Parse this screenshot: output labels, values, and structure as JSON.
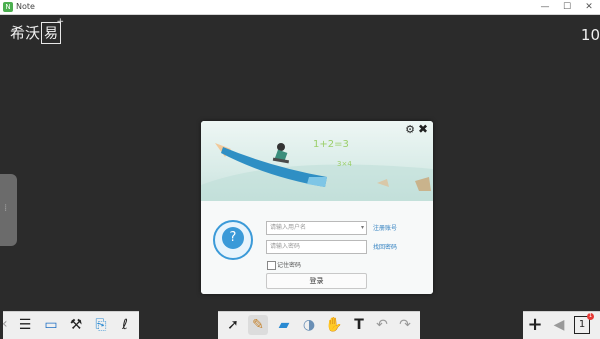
{
  "window": {
    "title": "Note",
    "buttons": [
      "—",
      "☐",
      "✕"
    ]
  },
  "logo": {
    "text": "希沃",
    "boxed": "易",
    "plus": "+"
  },
  "page_indicator": "10",
  "dialog": {
    "username_placeholder": "请输入用户名",
    "password_placeholder": "请输入密码",
    "register_link": "注册账号",
    "forgot_link": "找回密码",
    "remember_label": "记住密码",
    "login_button": "登录",
    "banner_text": "1+2=3"
  },
  "icons": {
    "left_toolbar": [
      "menu-icon",
      "monitor-icon",
      "tools-icon",
      "clipboard-icon",
      "curve-icon"
    ],
    "mid_toolbar": [
      "pointer-icon",
      "pen-icon",
      "eraser-icon",
      "shape-icon",
      "hand-icon",
      "text-icon",
      "undo-icon",
      "redo-icon"
    ],
    "right_toolbar": [
      "plus-icon",
      "prev-icon",
      "page-icon"
    ]
  },
  "colors": {
    "accent": "#3b9ad8",
    "background": "#2b2b2b",
    "link": "#2f7fc0"
  },
  "page_badge": "1"
}
